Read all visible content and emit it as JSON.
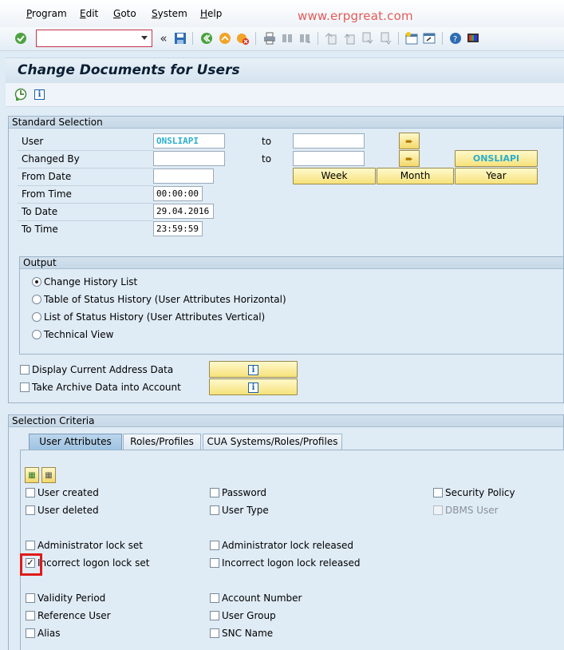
{
  "menu": {
    "program": {
      "u": "P",
      "rest": "rogram"
    },
    "edit": {
      "u": "E",
      "rest": "dit"
    },
    "goto": {
      "u": "G",
      "rest": "oto"
    },
    "system": {
      "u": "S",
      "rest": "ystem"
    },
    "help": {
      "u": "H",
      "rest": "elp"
    }
  },
  "watermark": "www.erpgreat.com",
  "toolbar": {
    "command_value": "",
    "icons": [
      "enter-icon",
      "back-chevron-icon",
      "save-icon",
      "back-icon",
      "exit-icon",
      "cancel-icon",
      "print-icon",
      "find-icon",
      "find-next-icon",
      "first-page-icon",
      "previous-page-icon",
      "next-page-icon",
      "last-page-icon",
      "create-session-icon",
      "shortcut-icon",
      "help-icon",
      "layout-icon"
    ]
  },
  "title": "Change Documents for Users",
  "standard_selection": {
    "title": "Standard Selection",
    "rows": [
      {
        "label": "User",
        "value": "ONSLIAPI"
      },
      {
        "label": "Changed By",
        "value": ""
      },
      {
        "label": "From Date",
        "value": ""
      },
      {
        "label": "From Time",
        "value": "00:00:00"
      },
      {
        "label": "To Date",
        "value": "29.04.2016"
      },
      {
        "label": "To Time",
        "value": "23:59:59"
      }
    ],
    "to_label": "to",
    "date_buttons": {
      "week": "Week",
      "month": "Month",
      "year": "Year",
      "top": "ONSLIAPI"
    }
  },
  "output": {
    "title": "Output",
    "options": [
      {
        "label": "Change History List",
        "selected": true
      },
      {
        "label": "Table of Status History (User Attributes Horizontal)",
        "selected": false
      },
      {
        "label": "List of Status History (User Attributes Vertical)",
        "selected": false
      },
      {
        "label": "Technical View",
        "selected": false
      }
    ]
  },
  "extra_options": [
    {
      "label": "Display Current Address Data",
      "checked": false
    },
    {
      "label": "Take Archive Data into Account",
      "checked": false
    }
  ],
  "selection_criteria": {
    "title": "Selection Criteria",
    "tabs": [
      "User Attributes",
      "Roles/Profiles",
      "CUA Systems/Roles/Profiles"
    ],
    "col1": [
      {
        "label": "User created",
        "checked": false
      },
      {
        "label": "User deleted",
        "checked": false
      },
      {
        "label": "Administrator lock set",
        "checked": false
      },
      {
        "label": "Incorrect logon lock set",
        "checked": true
      },
      {
        "label": "Validity Period",
        "checked": false
      },
      {
        "label": "Reference User",
        "checked": false
      },
      {
        "label": "Alias",
        "checked": false
      }
    ],
    "col2": [
      {
        "label": "Password",
        "checked": false
      },
      {
        "label": "User Type",
        "checked": false
      },
      {
        "label": "Administrator lock released",
        "checked": false
      },
      {
        "label": "Incorrect logon lock released",
        "checked": false
      },
      {
        "label": "Account Number",
        "checked": false
      },
      {
        "label": "User Group",
        "checked": false
      },
      {
        "label": "SNC Name",
        "checked": false
      }
    ],
    "col3": [
      {
        "label": "Security Policy",
        "checked": false,
        "disabled": false
      },
      {
        "label": "DBMS User",
        "checked": false,
        "disabled": true
      }
    ]
  },
  "colors": {
    "accent": "#1b5fa8",
    "highlight": "#e01a1a",
    "background": "#dfebf5"
  }
}
